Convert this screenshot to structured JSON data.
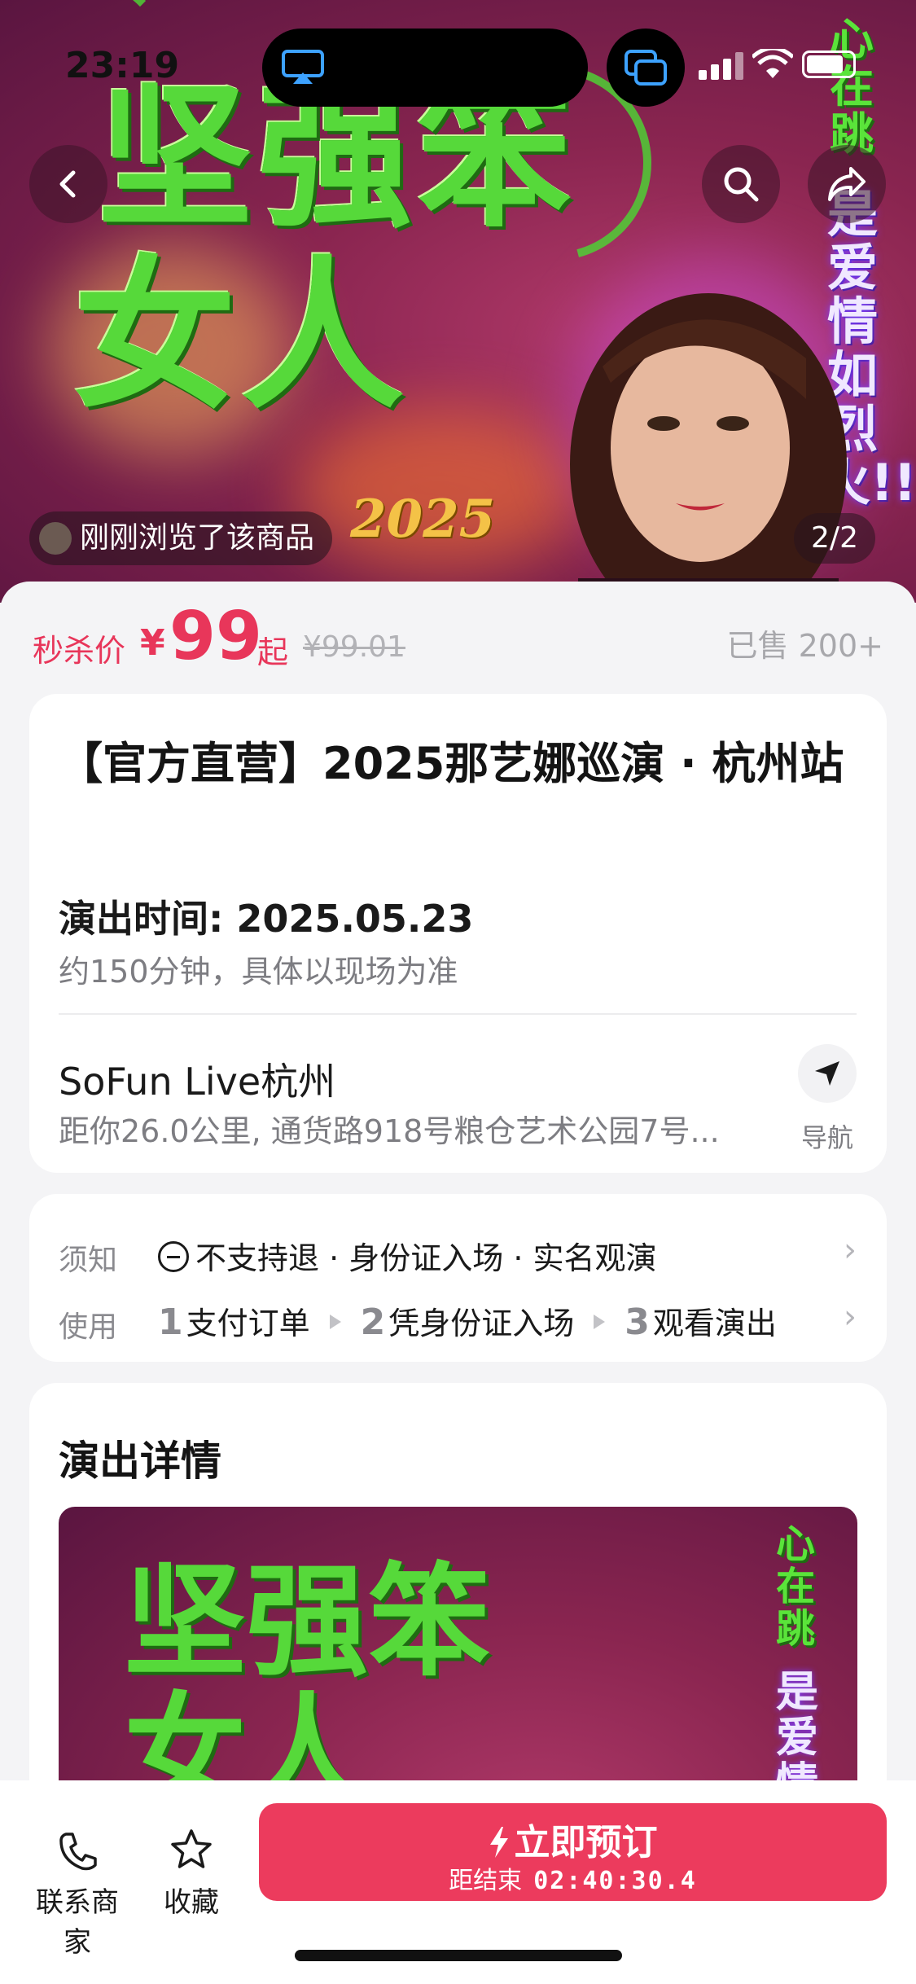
{
  "status": {
    "time": "23:19"
  },
  "hero": {
    "art_title_line1": "坚强笨",
    "art_title_line2": "女人",
    "side_top": "心在跳",
    "side_text": "是爱情如烈火!!",
    "year": "2025",
    "viewed_chip": "刚刚浏览了该商品",
    "page_indicator": "2/2"
  },
  "price": {
    "label": "秒杀价",
    "currency": "¥",
    "value": "99",
    "suffix": "起",
    "original": "¥99.01",
    "sold": "已售 200+"
  },
  "event": {
    "title": "【官方直营】2025那艺娜巡演 · 杭州站",
    "show_time": "演出时间: 2025.05.23",
    "duration": "约150分钟，具体以现场为准",
    "venue": "SoFun Live杭州",
    "address": "距你26.0公里, 通货路918号粮仓艺术公园7号...",
    "nav_label": "导航"
  },
  "notice": {
    "label": "须知",
    "text": "不支持退 · 身份证入场 · 实名观演",
    "usage_label": "使用",
    "steps": [
      {
        "num": "1",
        "label": "支付订单"
      },
      {
        "num": "2",
        "label": "凭身份证入场"
      },
      {
        "num": "3",
        "label": "观看演出"
      }
    ]
  },
  "detail": {
    "title": "演出详情"
  },
  "bottom": {
    "contact_label": "联系商家",
    "favorite_label": "收藏",
    "buy_label": "立即预订",
    "countdown_label": "距结束",
    "countdown": "02:40:30.4"
  },
  "colors": {
    "accent": "#ec3b5d",
    "price": "#e8365a",
    "art_green": "#56d93a"
  },
  "icons": [
    "back-icon",
    "search-icon",
    "share-icon",
    "airplay-icon",
    "pip-icon",
    "navigation-icon",
    "phone-icon",
    "star-icon",
    "lightning-icon"
  ]
}
